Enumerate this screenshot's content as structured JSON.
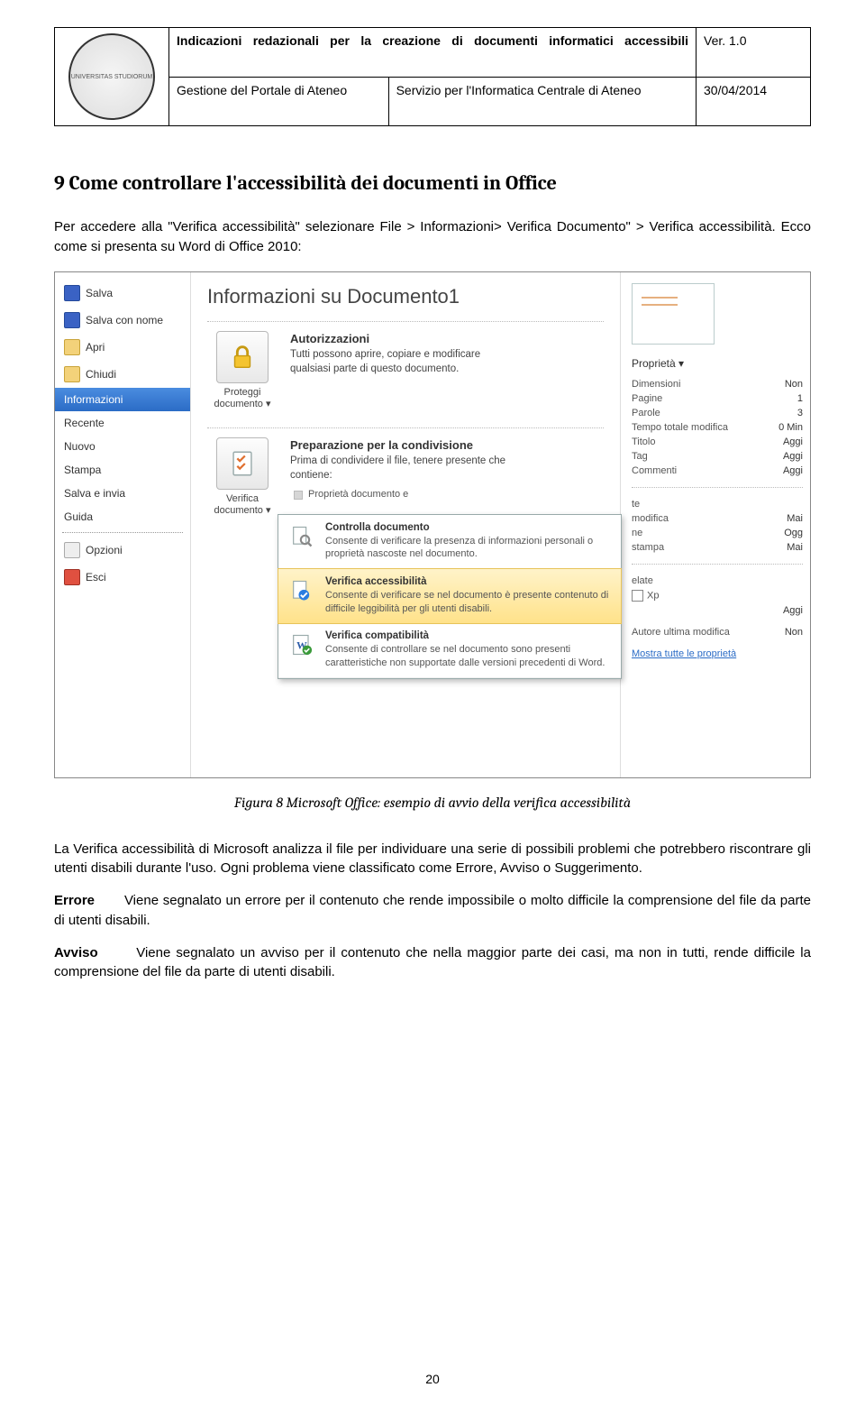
{
  "header": {
    "title": "Indicazioni redazionali per la creazione di documenti informatici accessibili",
    "sub1": "Gestione del Portale di Ateneo",
    "sub2": "Servizio per l'Informatica Centrale di Ateneo",
    "version": "Ver. 1.0",
    "date": "30/04/2014",
    "logo_alt": "UNIVERSITAS STUDIORUM"
  },
  "h2": "9 Come controllare l'accessibilità dei documenti in Office",
  "p1": "Per accedere alla \"Verifica accessibilità\" selezionare File > Informazioni> Verifica Documento\" > Verifica accessibilità. Ecco come si presenta su Word di Office 2010:",
  "caption": "Figura 8 Microsoft Office: esempio di avvio della verifica accessibilità",
  "p2": "La Verifica accessibilità di Microsoft analizza il file per individuare una serie di possibili problemi che potrebbero riscontrare gli utenti disabili durante l'uso. Ogni problema viene classificato come Errore, Avviso o Suggerimento.",
  "p3a": "Errore",
  "p3b": "Viene segnalato un errore per il contenuto che rende impossibile o molto difficile la comprensione del file da parte di utenti disabili.",
  "p4a": "Avviso",
  "p4b": "Viene segnalato un avviso per il contenuto che nella maggior parte dei casi, ma non in tutti, rende difficile la comprensione del file da parte di utenti disabili.",
  "pageno": "20",
  "shot": {
    "nav": {
      "save": "Salva",
      "saveas": "Salva con nome",
      "open": "Apri",
      "close": "Chiudi",
      "info": "Informazioni",
      "recent": "Recente",
      "new": "Nuovo",
      "print": "Stampa",
      "saveSend": "Salva e invia",
      "help": "Guida",
      "options": "Opzioni",
      "exit": "Esci"
    },
    "title": "Informazioni su Documento1",
    "tile1": {
      "btn": "Proteggi documento ▾",
      "head": "Autorizzazioni",
      "body": "Tutti possono aprire, copiare e modificare qualsiasi parte di questo documento."
    },
    "tile2": {
      "btn": "Verifica documento ▾",
      "head": "Preparazione per la condivisione",
      "body": "Prima di condividere il file, tenere presente che contiene:",
      "bullet": "Proprietà documento e"
    },
    "menu": {
      "m1h": "Controlla documento",
      "m1b": "Consente di verificare la presenza di informazioni personali o proprietà nascoste nel documento.",
      "m2h": "Verifica accessibilità",
      "m2b": "Consente di verificare se nel documento è presente contenuto di difficile leggibilità per gli utenti disabili.",
      "m3h": "Verifica compatibilità",
      "m3b": "Consente di controllare se nel documento sono presenti caratteristiche non supportate dalle versioni precedenti di Word."
    },
    "props": {
      "title": "Proprietà ▾",
      "rows": [
        {
          "k": "Dimensioni",
          "v": "Non"
        },
        {
          "k": "Pagine",
          "v": "1"
        },
        {
          "k": "Parole",
          "v": "3"
        },
        {
          "k": "Tempo totale modifica",
          "v": "0 Min"
        },
        {
          "k": "Titolo",
          "v": "Aggi"
        },
        {
          "k": "Tag",
          "v": "Aggi"
        },
        {
          "k": "Commenti",
          "v": "Aggi"
        }
      ],
      "sec2": "te",
      "rows2": [
        {
          "k": "modifica",
          "v": "Mai"
        },
        {
          "k": "ne",
          "v": "Ogg"
        },
        {
          "k": "stampa",
          "v": "Mai"
        }
      ],
      "sec3": "elate",
      "xp": "Xp",
      "agg": "Aggi",
      "author": "Autore ultima modifica",
      "authorv": "Non",
      "link": "Mostra tutte le proprietà"
    }
  }
}
